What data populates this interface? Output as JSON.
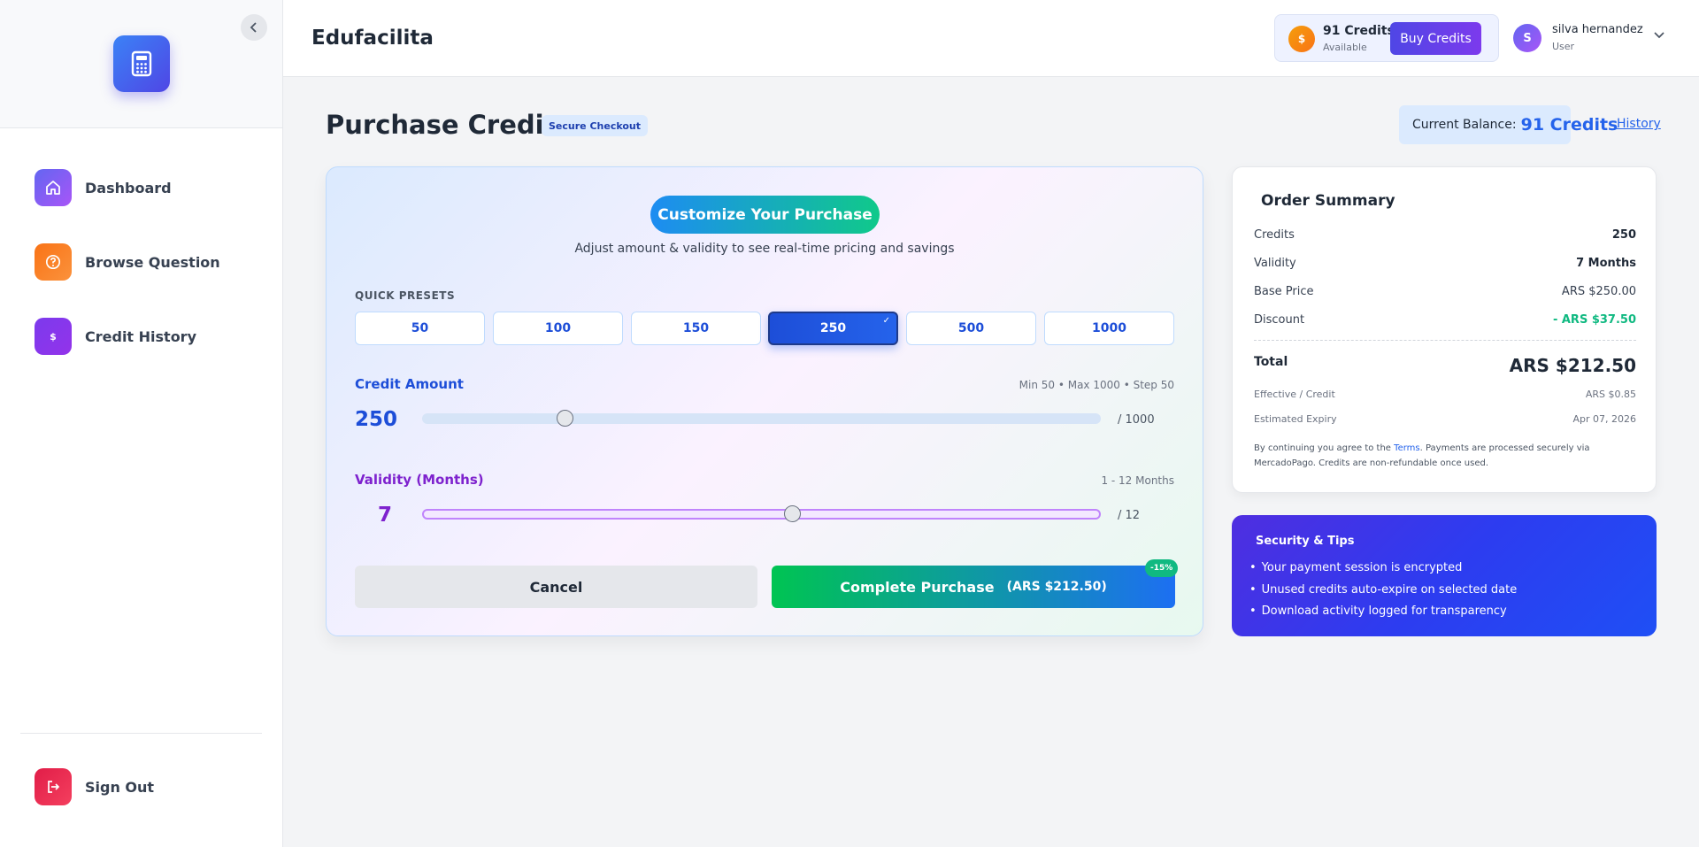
{
  "header": {
    "brand": "Edufacilita",
    "credits": "91 Credits",
    "credits_sub": "Available",
    "buy_label": "Buy Credits",
    "user_initial": "S",
    "user_name": "silva hernandez",
    "user_role": "User"
  },
  "sidebar": {
    "items": [
      {
        "label": "Dashboard",
        "icon": "home-icon"
      },
      {
        "label": "Browse Question",
        "icon": "question-circle-icon"
      },
      {
        "label": "Credit History",
        "icon": "dollar-icon",
        "glyph": "$"
      }
    ],
    "sign_out": "Sign Out"
  },
  "page": {
    "title": "Purchase Credits",
    "badge": "Secure Checkout",
    "balance_label": "Current Balance:",
    "balance_value": "91 Credits",
    "history_link": "History"
  },
  "purchase": {
    "customize_label": "Customize Your Purchase",
    "subtitle": "Adjust amount & validity to see real-time pricing and savings",
    "presets_label": "QUICK PRESETS",
    "presets": [
      "50",
      "100",
      "150",
      "250",
      "500",
      "1000"
    ],
    "selected_preset": "250",
    "check_glyph": "✓",
    "amount_label": "Credit Amount",
    "amount_meta": "Min 50 • Max 1000 • Step 50",
    "amount_value": "250",
    "amount_max": "/ 1000",
    "amount_slider": {
      "min": 50,
      "max": 1000,
      "value": 250
    },
    "validity_label": "Validity (Months)",
    "validity_meta": "1 - 12 Months",
    "validity_value": "7",
    "validity_max": "/ 12",
    "validity_slider": {
      "min": 1,
      "max": 12,
      "value": 7
    },
    "cancel_label": "Cancel",
    "complete_label": "Complete Purchase",
    "complete_amount": "(ARS $212.50)",
    "discount_badge": "-15%"
  },
  "summary": {
    "title": "Order Summary",
    "credits_label": "Credits",
    "credits_value": "250",
    "validity_label": "Validity",
    "validity_value": "7 Months",
    "base_label": "Base Price",
    "base_value": "ARS $250.00",
    "discount_label": "Discount",
    "discount_value": "- ARS $37.50",
    "total_label": "Total",
    "total_value": "ARS $212.50",
    "effective_label": "Effective / Credit",
    "effective_value": "ARS $0.85",
    "expiry_label": "Estimated Expiry",
    "expiry_value": "Apr 07, 2026",
    "terms_before": "By continuing you agree to the",
    "terms_link": "Terms",
    "terms_after": ". Payments are processed securely via MercadoPago. Credits are non-refundable once used."
  },
  "tips": {
    "title": "Security & Tips",
    "items": [
      "Your payment session is encrypted",
      "Unused credits auto-expire on selected date",
      "Download activity logged for transparency"
    ]
  },
  "colors": {
    "primary": "#2563eb",
    "accent_purple": "#7e22ce",
    "success": "#10b981"
  }
}
